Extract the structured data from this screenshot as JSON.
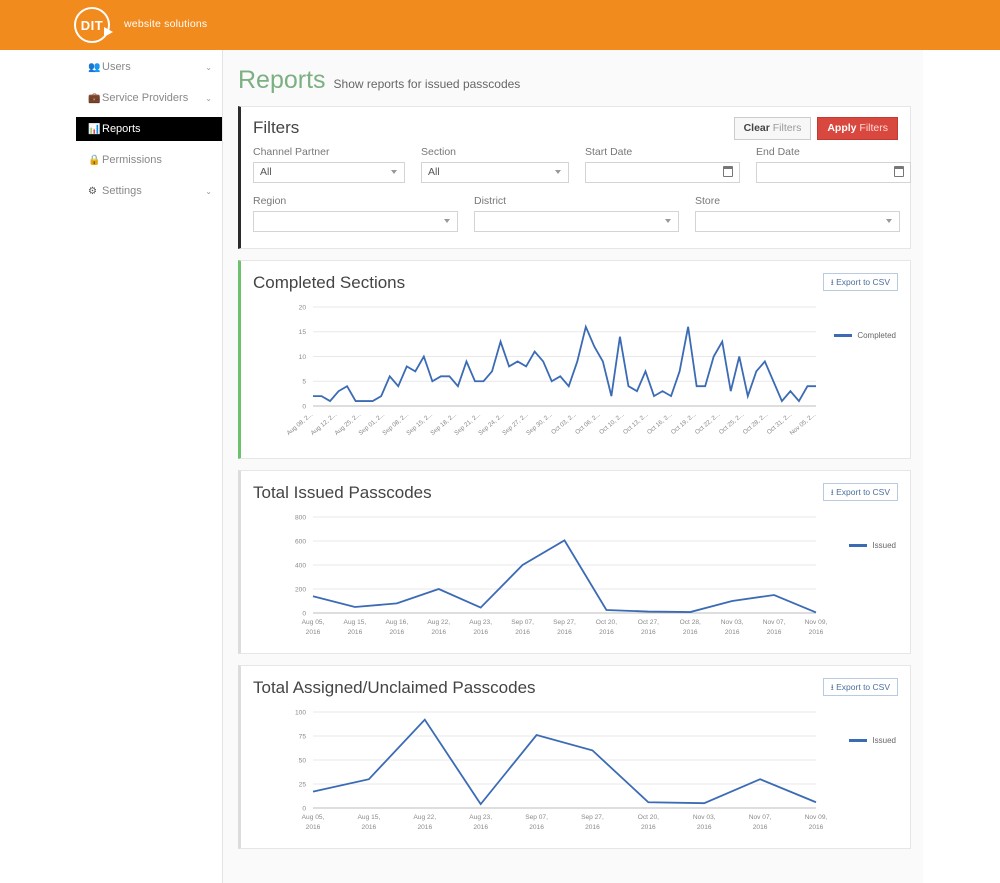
{
  "brand": {
    "logo_text": "DIT",
    "tagline": "website solutions",
    "bar_color": "#f28b1e"
  },
  "sidebar": {
    "items": [
      {
        "label": "Users",
        "icon": "users-icon",
        "caret": "⌄",
        "active": false
      },
      {
        "label": "Service Providers",
        "icon": "briefcase-icon",
        "caret": "⌄",
        "active": false
      },
      {
        "label": "Reports",
        "icon": "bar-chart-icon",
        "caret": "",
        "active": true
      },
      {
        "label": "Permissions",
        "icon": "lock-icon",
        "caret": "",
        "active": false
      },
      {
        "label": "Settings",
        "icon": "gear-icon",
        "caret": "⌄",
        "active": false
      }
    ]
  },
  "page": {
    "title": "Reports",
    "subtitle": "Show reports for issued passcodes",
    "title_color": "#7cb083"
  },
  "filters": {
    "title": "Filters",
    "clear_button": {
      "strong": "Clear",
      "rest": " Filters"
    },
    "apply_button": {
      "strong": "Apply",
      "rest": " Filters"
    },
    "fields": [
      {
        "label": "Channel Partner",
        "value": "All",
        "type": "select"
      },
      {
        "label": "Section",
        "value": "All",
        "type": "select"
      },
      {
        "label": "Start Date",
        "value": "",
        "placeholder": "",
        "type": "date"
      },
      {
        "label": "End Date",
        "value": "",
        "placeholder": "",
        "type": "date"
      },
      {
        "label": "Region",
        "value": "",
        "type": "select"
      },
      {
        "label": "District",
        "value": "",
        "type": "select"
      },
      {
        "label": "Store",
        "value": "",
        "type": "select"
      }
    ]
  },
  "export_button_label": "Export to CSV",
  "charts": [
    {
      "title": "Completed Sections",
      "accent": "#6cc26c"
    },
    {
      "title": "Total Issued Passcodes",
      "accent": "#dcdcdc"
    },
    {
      "title": "Total Assigned/Unclaimed Passcodes",
      "accent": "#dcdcdc"
    }
  ],
  "chart_data": [
    {
      "type": "line",
      "title": "Completed Sections",
      "xlabel": "",
      "ylabel": "",
      "ylim": [
        0,
        20
      ],
      "yticks": [
        0,
        5,
        10,
        15,
        20
      ],
      "grid": true,
      "legend_position": "right",
      "series": [
        {
          "name": "Completed",
          "color": "#3b6bb5",
          "values": [
            2,
            2,
            1,
            3,
            4,
            1,
            1,
            1,
            2,
            6,
            4,
            8,
            7,
            10,
            5,
            6,
            6,
            4,
            9,
            5,
            5,
            7,
            13,
            8,
            9,
            8,
            11,
            9,
            5,
            6,
            4,
            9,
            16,
            12,
            9,
            2,
            14,
            4,
            3,
            7,
            2,
            3,
            2,
            7,
            16,
            4,
            4,
            10,
            13,
            3,
            10,
            2,
            7,
            9,
            5,
            1,
            3,
            1,
            4,
            4
          ]
        }
      ],
      "tick_labels": [
        "Aug 08, 2...",
        "Aug 12, 2...",
        "Aug 25, 2...",
        "Sep 01, 2...",
        "Sep 08, 2...",
        "Sep 15, 2...",
        "Sep 18, 2...",
        "Sep 21, 2...",
        "Sep 24, 2...",
        "Sep 27, 2...",
        "Sep 30, 2...",
        "Oct 03, 2...",
        "Oct 06, 2...",
        "Oct 10, 2...",
        "Oct 13, 2...",
        "Oct 16, 2...",
        "Oct 19, 2...",
        "Oct 22, 2...",
        "Oct 25, 2...",
        "Oct 28, 2...",
        "Oct 31, 2...",
        "Nov 05, 2..."
      ]
    },
    {
      "type": "line",
      "title": "Total Issued Passcodes",
      "xlabel": "",
      "ylabel": "",
      "ylim": [
        0,
        800
      ],
      "yticks": [
        0,
        200,
        400,
        600,
        800
      ],
      "grid": true,
      "legend_position": "right",
      "categories": [
        "Aug 05, 2016",
        "Aug 15, 2016",
        "Aug 16, 2016",
        "Aug 22, 2016",
        "Aug 23, 2016",
        "Sep 07, 2016",
        "Sep 27, 2016",
        "Oct 20, 2016",
        "Oct 27, 2016",
        "Oct 28, 2016",
        "Nov 03, 2016",
        "Nov 07, 2016",
        "Nov 09, 2016"
      ],
      "series": [
        {
          "name": "Issued",
          "color": "#3b6bb5",
          "values": [
            140,
            50,
            80,
            200,
            45,
            400,
            605,
            25,
            12,
            8,
            100,
            150,
            5
          ]
        }
      ]
    },
    {
      "type": "line",
      "title": "Total Assigned/Unclaimed Passcodes",
      "xlabel": "",
      "ylabel": "",
      "ylim": [
        0,
        100
      ],
      "yticks": [
        0,
        25,
        50,
        75,
        100
      ],
      "grid": true,
      "legend_position": "right",
      "categories": [
        "Aug 05, 2016",
        "Aug 15, 2016",
        "Aug 22, 2016",
        "Aug 23, 2016",
        "Sep 07, 2016",
        "Sep 27, 2016",
        "Oct 20, 2016",
        "Nov 03, 2016",
        "Nov 07, 2016",
        "Nov 09, 2016"
      ],
      "series": [
        {
          "name": "Issued",
          "color": "#3b6bb5",
          "values": [
            17,
            30,
            92,
            4,
            76,
            60,
            6,
            5,
            30,
            6
          ]
        }
      ]
    }
  ]
}
